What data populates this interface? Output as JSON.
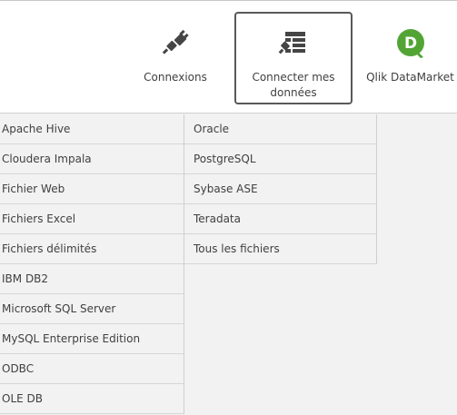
{
  "toolbar": {
    "items": [
      {
        "label": "Connexions",
        "icon": "plug-icon"
      },
      {
        "label": "Connecter mes données",
        "icon": "table-connect-icon"
      },
      {
        "label": "Qlik DataMarket",
        "icon": "qlik-datamarket-logo"
      }
    ],
    "selected_index": 1,
    "qlik_logo_letter": "D",
    "colors": {
      "qlik_green": "#52a535",
      "icon_dark": "#454545"
    }
  },
  "sources": {
    "left": [
      "Apache Hive",
      "Cloudera Impala",
      "Fichier Web",
      "Fichiers Excel",
      "Fichiers délimités",
      "IBM DB2",
      "Microsoft SQL Server",
      "MySQL Enterprise Edition",
      "ODBC",
      "OLE DB"
    ],
    "right": [
      "Oracle",
      "PostgreSQL",
      "Sybase ASE",
      "Teradata",
      "Tous les fichiers"
    ]
  }
}
